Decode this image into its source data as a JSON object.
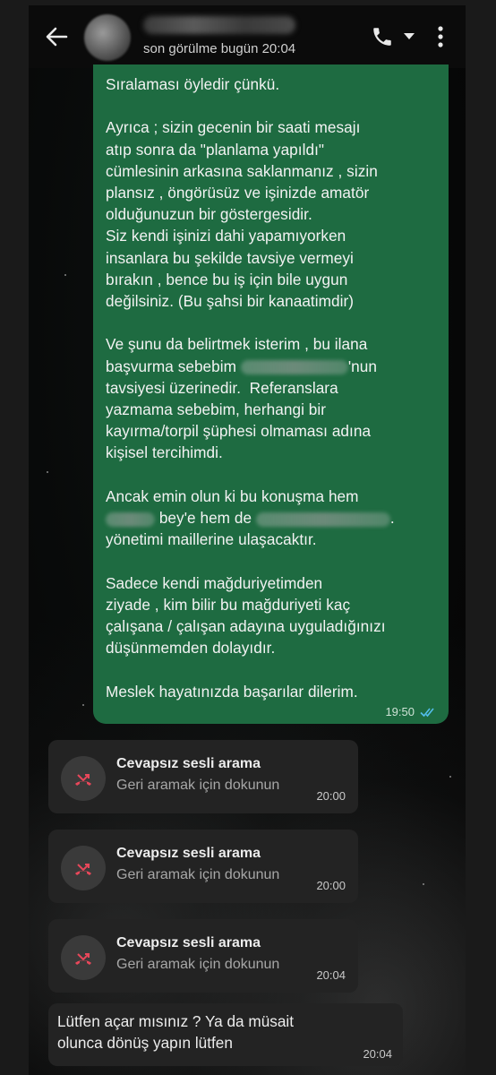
{
  "header": {
    "back_icon": "arrow-left-icon",
    "last_seen": "son görülme bugün 20:04",
    "call_icon": "phone-icon",
    "menu_icon": "more-vertical-icon"
  },
  "outgoing_message": {
    "lines": [
      "Sıralaması öyledir çünkü.",
      "",
      "Ayrıca ; sizin gecenin bir saati mesajı",
      "atıp sonra da \"planlama yapıldı\"",
      "cümlesinin arkasına saklanmanız , sizin",
      "plansız , öngörüsüz ve işinizde amatör",
      "olduğunuzun bir göstergesidir.",
      "Siz kendi işinizi dahi yapamıyorken",
      "insanlara bu şekilde tavsiye vermeyi",
      "bırakın , bence bu iş için bile uygun",
      "değilsiniz. (Bu şahsi bir kanaatimdir)",
      "",
      "Ve şunu da belirtmek isterim , bu ilana",
      "başvurma sebebim",
      "'nun",
      "tavsiyesi üzerinedir.  Referanslara",
      "yazmama sebebim, herhangi bir",
      "kayırma/torpil şüphesi olmaması adına",
      "kişisel tercihimdi.",
      "",
      "Ancak emin olun ki bu konuşma hem",
      "bey'e hem de",
      "yönetimi maillerine ulaşacaktır.",
      "",
      "Sadece kendi mağduriyetimden",
      "ziyade , kim bilir bu mağduriyeti kaç",
      "çalışana / çalışan adayına uyguladığınızı",
      "düşünmemden dolayıdır.",
      "",
      "Meslek hayatınızda başarılar dilerim."
    ],
    "time": "19:50",
    "status": "read-double-check"
  },
  "missed_calls": [
    {
      "title": "Cevapsız sesli arama",
      "subtitle": "Geri aramak için dokunun",
      "time": "20:00"
    },
    {
      "title": "Cevapsız sesli arama",
      "subtitle": "Geri aramak için dokunun",
      "time": "20:00"
    },
    {
      "title": "Cevapsız sesli arama",
      "subtitle": "Geri aramak için dokunun",
      "time": "20:04"
    }
  ],
  "incoming_message": {
    "line1": "Lütfen açar mısınız ? Ya da müsait",
    "line2": "olunca dönüş yapın lütfen",
    "time": "20:04"
  },
  "colors": {
    "outgoing_bubble": "#1e6b41",
    "incoming_bubble": "#232323",
    "missed_call_icon": "#e8475a",
    "read_ticks": "#53bdeb"
  }
}
